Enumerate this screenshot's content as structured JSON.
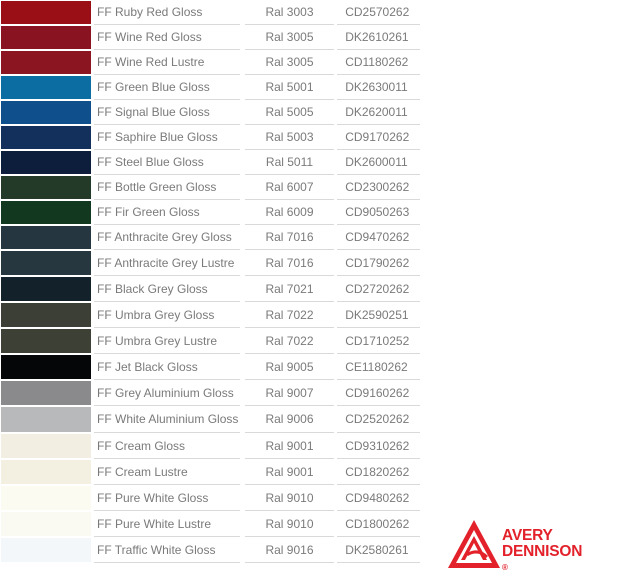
{
  "colors": {
    "label_text": "#7a7a7a",
    "divider": "#d9d9d9",
    "brand": "#e3212b"
  },
  "rows": [
    {
      "name": "FF Ruby Red Gloss",
      "ral": "Ral 3003",
      "code": "CD2570262",
      "swatch": "#9a0f16"
    },
    {
      "name": "FF Wine Red Gloss",
      "ral": "Ral 3005",
      "code": "DK2610261",
      "swatch": "#8a1322"
    },
    {
      "name": "FF Wine Red Lustre",
      "ral": "Ral 3005",
      "code": "CD1180262",
      "swatch": "#8b1521"
    },
    {
      "name": "FF Green Blue Gloss",
      "ral": "Ral 5001",
      "code": "DK2630011",
      "swatch": "#0b6da1"
    },
    {
      "name": "FF Signal Blue Gloss",
      "ral": "Ral 5005",
      "code": "DK2620011",
      "swatch": "#0f4f8c"
    },
    {
      "name": "FF Saphire Blue Gloss",
      "ral": "Ral 5003",
      "code": "CD9170262",
      "swatch": "#13305d"
    },
    {
      "name": "FF Steel Blue Gloss",
      "ral": "Ral 5011",
      "code": "DK2600011",
      "swatch": "#0d1d3c"
    },
    {
      "name": "FF Bottle Green Gloss",
      "ral": "Ral 6007",
      "code": "CD2300262",
      "swatch": "#243a28"
    },
    {
      "name": "FF Fir Green Gloss",
      "ral": "Ral 6009",
      "code": "CD9050263",
      "swatch": "#12391f"
    },
    {
      "name": "FF Anthracite Grey Gloss",
      "ral": "Ral 7016",
      "code": "CD9470262",
      "swatch": "#263640"
    },
    {
      "name": "FF Anthracite Grey Lustre",
      "ral": "Ral 7016",
      "code": "CD1790262",
      "swatch": "#27373f"
    },
    {
      "name": "FF Black Grey Gloss",
      "ral": "Ral 7021",
      "code": "CD2720262",
      "swatch": "#13222a"
    },
    {
      "name": "FF Umbra Grey Gloss",
      "ral": "Ral 7022",
      "code": "DK2590251",
      "swatch": "#3c3f36"
    },
    {
      "name": "FF Umbra Grey Lustre",
      "ral": "Ral 7022",
      "code": "CD1710252",
      "swatch": "#3d4035"
    },
    {
      "name": "FF Jet Black Gloss",
      "ral": "Ral 9005",
      "code": "CE1180262",
      "swatch": "#050608"
    },
    {
      "name": "FF Grey Aluminium Gloss",
      "ral": "Ral 9007",
      "code": "CD9160262",
      "swatch": "#8a8a8c"
    },
    {
      "name": "FF White Aluminium Gloss",
      "ral": "Ral 9006",
      "code": "CD2520262",
      "swatch": "#b8b9bb"
    },
    {
      "name": "FF Cream Gloss",
      "ral": "Ral 9001",
      "code": "CD9310262",
      "swatch": "#f2efe2"
    },
    {
      "name": "FF Cream Lustre",
      "ral": "Ral 9001",
      "code": "CD1820262",
      "swatch": "#f3f0e2"
    },
    {
      "name": "FF Pure White Gloss",
      "ral": "Ral 9010",
      "code": "CD9480262",
      "swatch": "#fbfbf2"
    },
    {
      "name": "FF Pure White Lustre",
      "ral": "Ral 9010",
      "code": "CD1800262",
      "swatch": "#fafaf2"
    },
    {
      "name": "FF Traffic White Gloss",
      "ral": "Ral 9016",
      "code": "DK2580261",
      "swatch": "#f4f7fa"
    }
  ],
  "logo": {
    "line1": "AVERY",
    "line2": "DENNISON",
    "registered": "®",
    "icon": "avery-dennison-triangle-icon"
  }
}
